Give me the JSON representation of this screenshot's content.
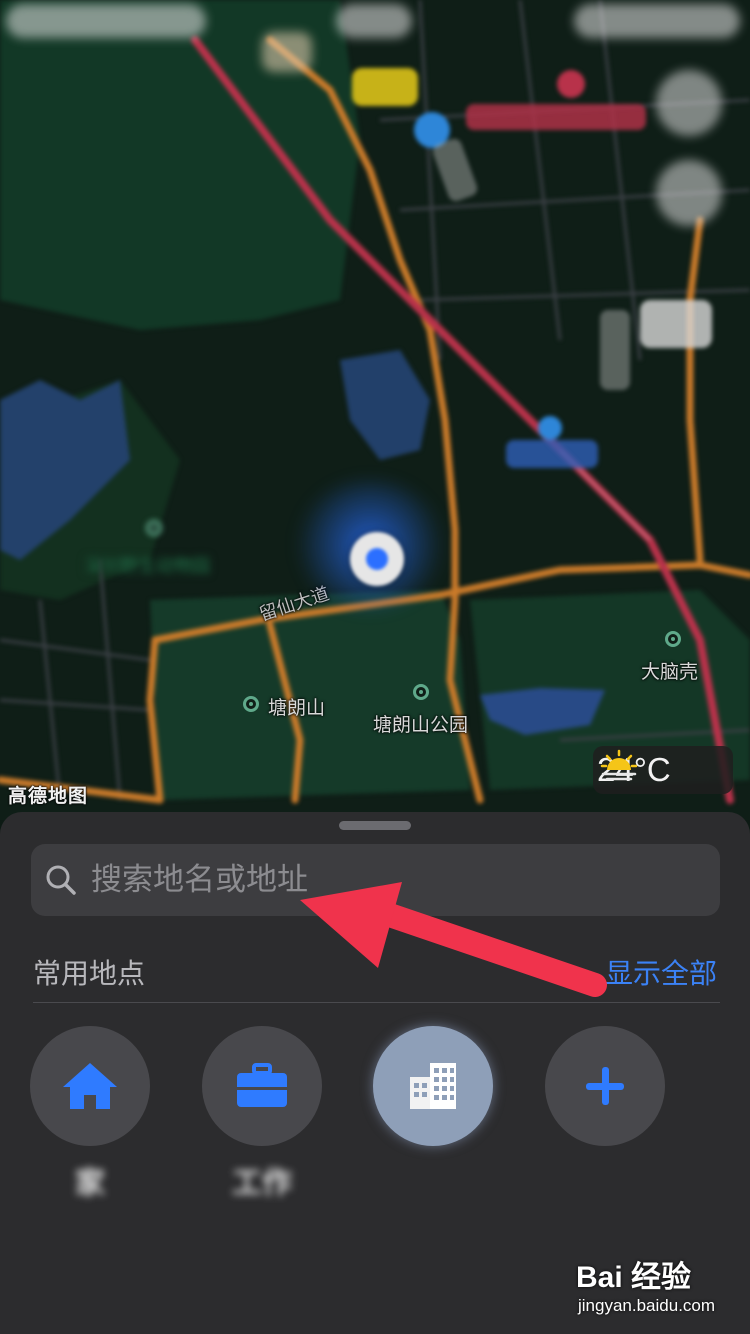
{
  "status_bar": {
    "carrier": "",
    "time": "",
    "battery": ""
  },
  "map": {
    "road_label": "留仙大道",
    "poi_1": "塘朗山",
    "poi_2": "塘朗山公园",
    "poi_3": "大脑壳",
    "poi_blurred_1": "深圳野生动物园",
    "poi_blurred_2": "",
    "brand_logo": "高德地图",
    "weather_temp": "24°C",
    "weather_icon": "sunrise-icon"
  },
  "sheet": {
    "search_placeholder": "搜索地名或地址",
    "section_title": "常用地点",
    "show_all": "显示全部",
    "places": [
      {
        "icon": "home-icon",
        "label": "家",
        "sub": ""
      },
      {
        "icon": "briefcase-icon",
        "label": "工作",
        "sub": ""
      },
      {
        "icon": "building-icon",
        "label": "",
        "sub": ""
      },
      {
        "icon": "plus-icon",
        "label": "",
        "sub": ""
      }
    ],
    "more_label": ""
  },
  "colors": {
    "accent": "#3b82f6",
    "annotation_arrow": "#f0334c",
    "sheet_bg": "#2c2c2e"
  },
  "watermark": {
    "main": "Bai 经验",
    "sub": "jingyan.baidu.com"
  }
}
